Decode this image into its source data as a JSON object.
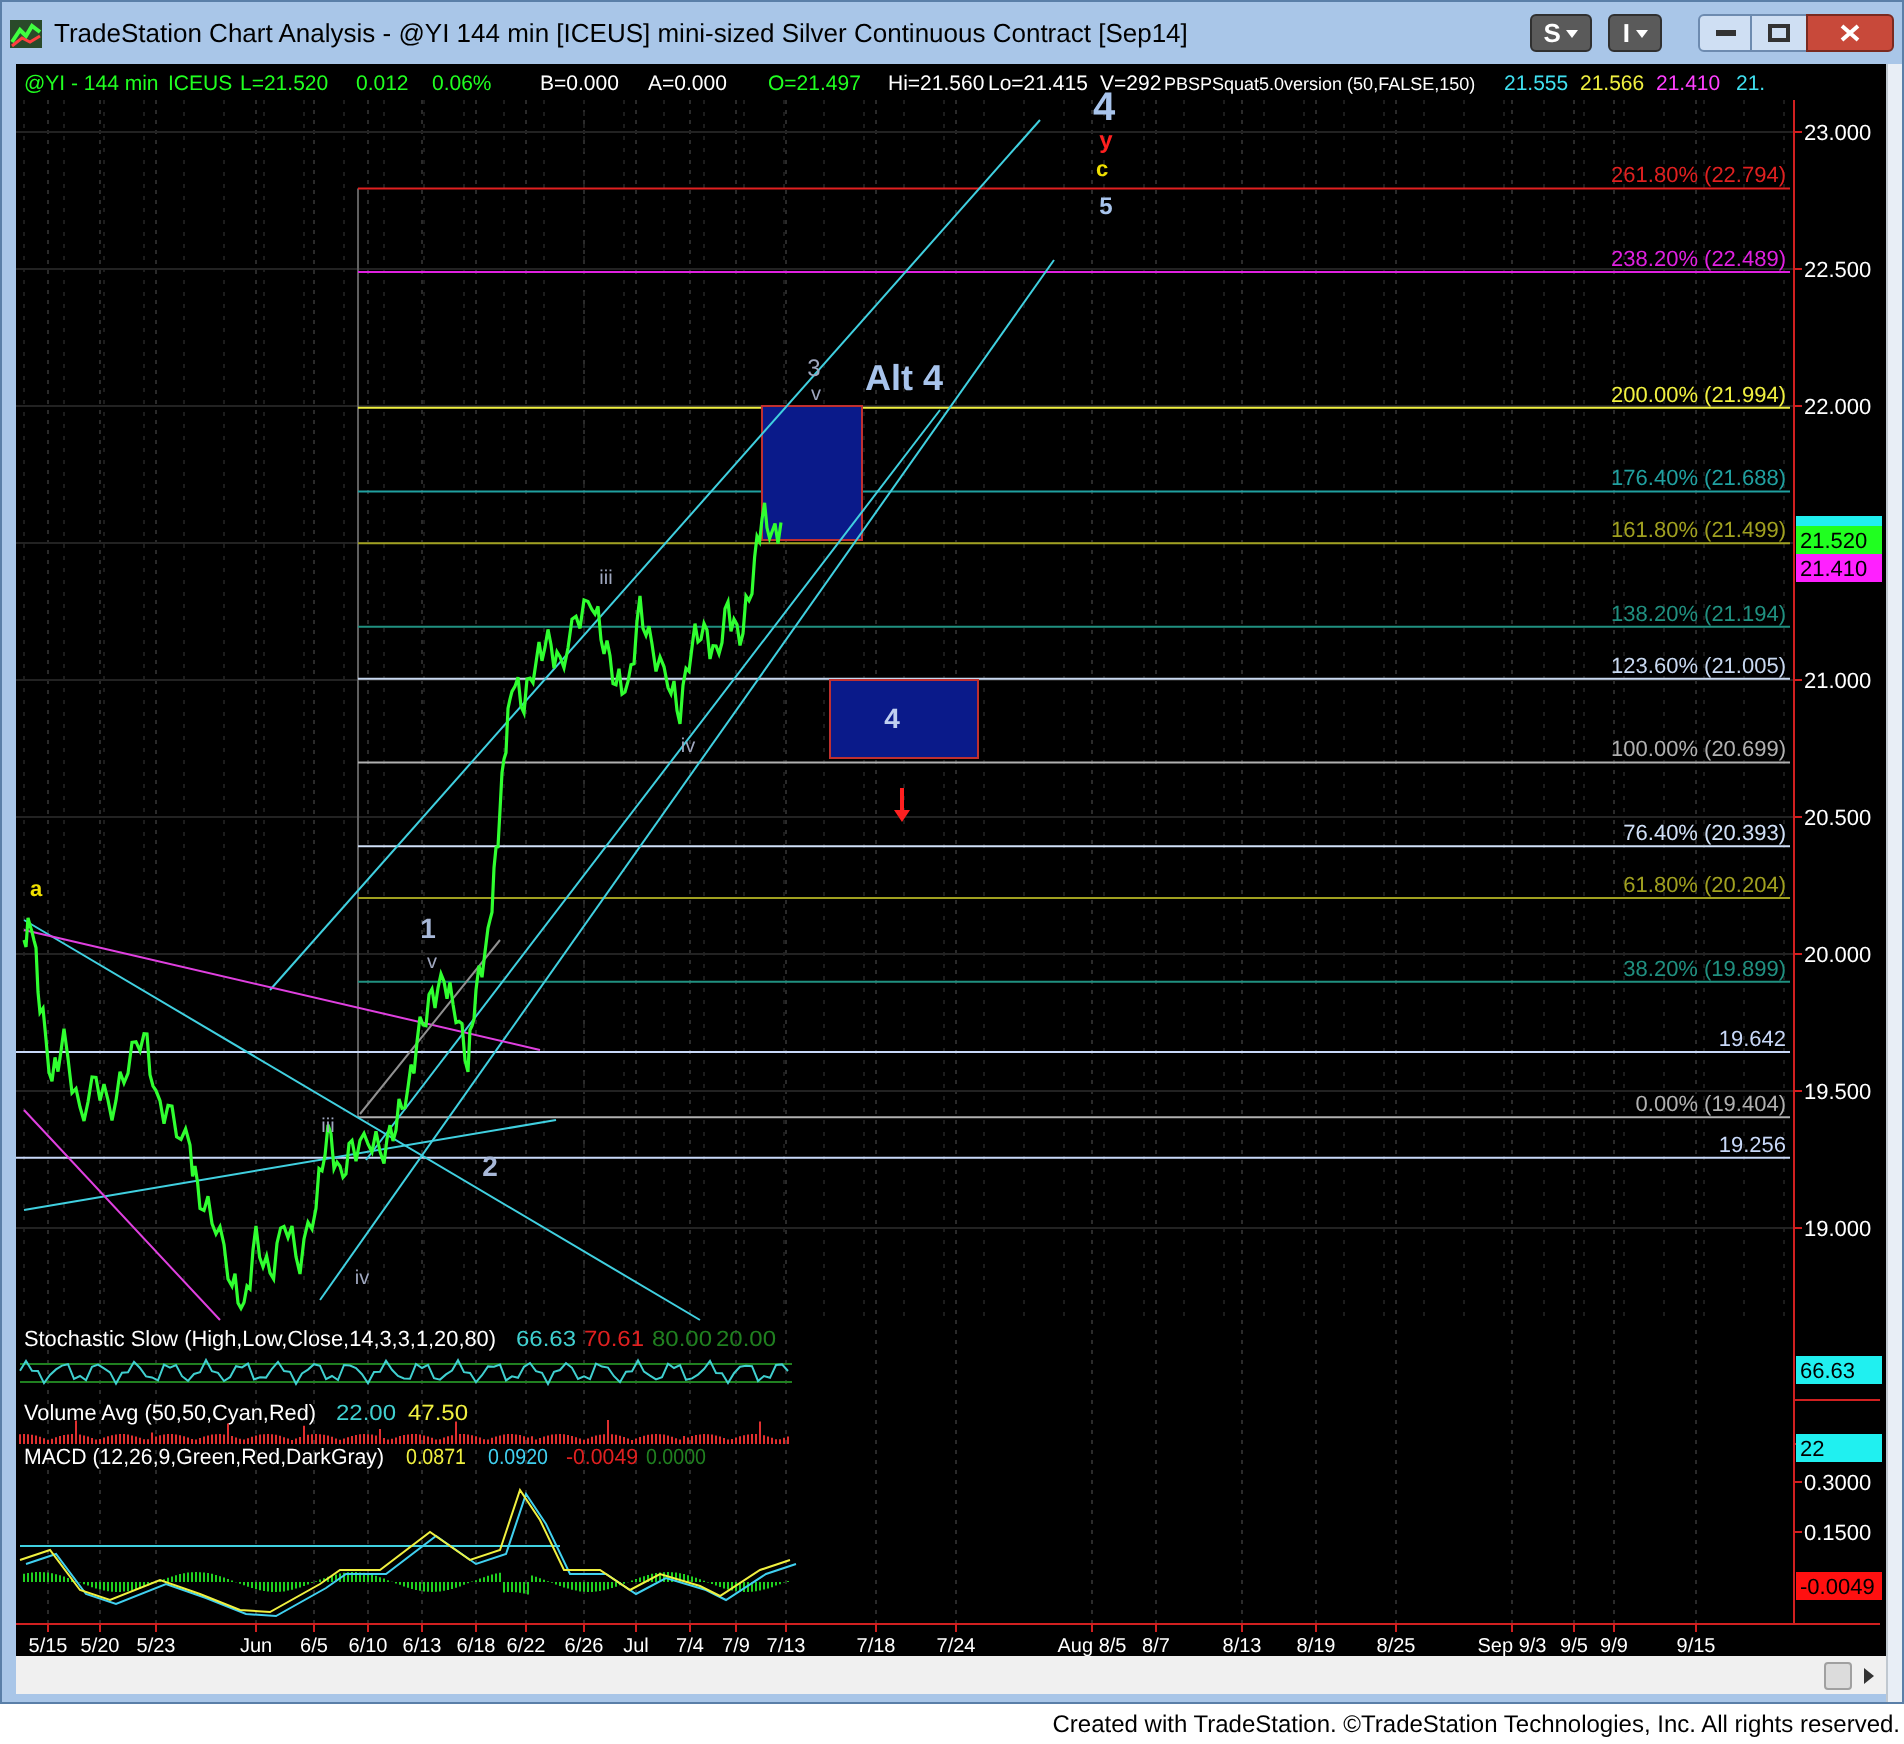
{
  "window": {
    "title": "TradeStation Chart Analysis - @YI 144 min [ICEUS] mini-sized Silver Continuous Contract [Sep14]",
    "menu_buttons": [
      {
        "label": "S"
      },
      {
        "label": "I"
      }
    ]
  },
  "status_line": [
    {
      "text": "@YI - 144 min",
      "color": "#20ff20"
    },
    {
      "text": "ICEUS",
      "color": "#20ff20"
    },
    {
      "text": "L=21.520",
      "color": "#20ff20"
    },
    {
      "text": "0.012",
      "color": "#20ff20"
    },
    {
      "text": "0.06%",
      "color": "#20ff20"
    },
    {
      "text": "B=0.000",
      "color": "#ffffff"
    },
    {
      "text": "A=0.000",
      "color": "#ffffff"
    },
    {
      "text": "O=21.497",
      "color": "#20ff20"
    },
    {
      "text": "Hi=21.560",
      "color": "#ffffff"
    },
    {
      "text": "Lo=21.415",
      "color": "#ffffff"
    },
    {
      "text": "V=292",
      "color": "#ffffff"
    },
    {
      "text": "PBSPSquat5.0version (50,FALSE,150)",
      "color": "#ffffff"
    },
    {
      "text": "21.555",
      "color": "#40e0f0"
    },
    {
      "text": "21.566",
      "color": "#f0f040"
    },
    {
      "text": "21.410",
      "color": "#ff40ff"
    },
    {
      "text": "21.",
      "color": "#40e0f0"
    }
  ],
  "price_chart": {
    "wave_labels": [
      {
        "text": "4",
        "color": "#a8c4ec"
      },
      {
        "text": "y",
        "color": "#ff2020"
      },
      {
        "text": "c",
        "color": "#f0e000"
      },
      {
        "text": "5",
        "color": "#a8c4ec"
      },
      {
        "text": "3",
        "color": "#a0a8c0"
      },
      {
        "text": "v",
        "color": "#a0a8c0"
      },
      {
        "text": "Alt 4",
        "color": "#a8c4ec"
      },
      {
        "text": "iii",
        "color": "#a0a8c0"
      },
      {
        "text": "iv",
        "color": "#a0a8c0"
      },
      {
        "text": "1",
        "color": "#a8b8d8"
      },
      {
        "text": "v",
        "color": "#a0a8c0"
      },
      {
        "text": "iii",
        "color": "#a0a8c0"
      },
      {
        "text": "2",
        "color": "#a8b8d8"
      },
      {
        "text": "iv",
        "color": "#a0a8c0"
      },
      {
        "text": "a",
        "color": "#f0e000"
      }
    ],
    "zone_labels": [
      {
        "text": "4"
      }
    ],
    "fib_levels": [
      {
        "label": "261.80% (22.794)",
        "color": "#e02020"
      },
      {
        "label": "238.20% (22.489)",
        "color": "#e020e0"
      },
      {
        "label": "200.00% (21.994)",
        "color": "#f0f040"
      },
      {
        "label": "176.40% (21.688)",
        "color": "#20a0a0"
      },
      {
        "label": "161.80% (21.499)",
        "color": "#a0a020"
      },
      {
        "label": "138.20% (21.194)",
        "color": "#209080"
      },
      {
        "label": "123.60% (21.005)",
        "color": "#c8d8f0"
      },
      {
        "label": "100.00% (20.699)",
        "color": "#b0b0b0"
      },
      {
        "label": "76.40% (20.393)",
        "color": "#d0e0f8"
      },
      {
        "label": "61.80% (20.204)",
        "color": "#a0a020"
      },
      {
        "label": "38.20% (19.899)",
        "color": "#209080"
      },
      {
        "label": "19.642",
        "color": "#c8d8f8"
      },
      {
        "label": "0.00% (19.404)",
        "color": "#b0b0b0"
      },
      {
        "label": "19.256",
        "color": "#c8d8f8"
      }
    ],
    "price_axis": [
      "23.000",
      "22.500",
      "22.000",
      "21.000",
      "20.500",
      "20.000",
      "19.500",
      "19.000"
    ],
    "last_price_markers": [
      {
        "text": "21.520",
        "color": "#20ff20"
      },
      {
        "text": "21.410",
        "color": "#ff20ff"
      }
    ]
  },
  "indicators": [
    {
      "kind": "stochastic",
      "title": "Stochastic Slow (High,Low,Close,14,3,3,1,20,80)",
      "values": [
        {
          "text": "66.63",
          "color": "#40d0d0"
        },
        {
          "text": "70.61",
          "color": "#e02020"
        },
        {
          "text": "80.00",
          "color": "#208020"
        },
        {
          "text": "20.00",
          "color": "#208020"
        }
      ],
      "axis_markers": [
        {
          "text": "66.63",
          "color": "#20f0f0"
        }
      ]
    },
    {
      "kind": "volume",
      "title": "Volume Avg (50,50,Cyan,Red)",
      "values": [
        {
          "text": "22.00",
          "color": "#40d0d0"
        },
        {
          "text": "47.50",
          "color": "#f0f040"
        }
      ],
      "axis_markers": [
        {
          "text": "22",
          "color": "#20f0f0"
        }
      ]
    },
    {
      "kind": "macd",
      "title": "MACD (12,26,9,Green,Red,DarkGray)",
      "values": [
        {
          "text": "0.0871",
          "color": "#f0f040"
        },
        {
          "text": "0.0920",
          "color": "#40d0f0"
        },
        {
          "text": "-0.0049",
          "color": "#e02020"
        },
        {
          "text": "0.0000",
          "color": "#208020"
        }
      ],
      "ticks": [
        "0.3000",
        "0.1500"
      ],
      "axis_markers": [
        {
          "text": "-0.0049",
          "color": "#ff1010"
        }
      ]
    }
  ],
  "date_axis": [
    "5/15",
    "5/20",
    "5/23",
    "Jun",
    "6/5",
    "6/10",
    "6/13",
    "6/18",
    "6/22",
    "6/26",
    "Jul",
    "7/4",
    "7/9",
    "7/13",
    "7/18",
    "7/24",
    "Aug 8/5",
    "8/7",
    "8/13",
    "8/19",
    "8/25",
    "Sep 9/3",
    "9/5",
    "9/9",
    "9/15"
  ],
  "footer": "Created with TradeStation. ©TradeStation Technologies, Inc. All rights reserved."
}
